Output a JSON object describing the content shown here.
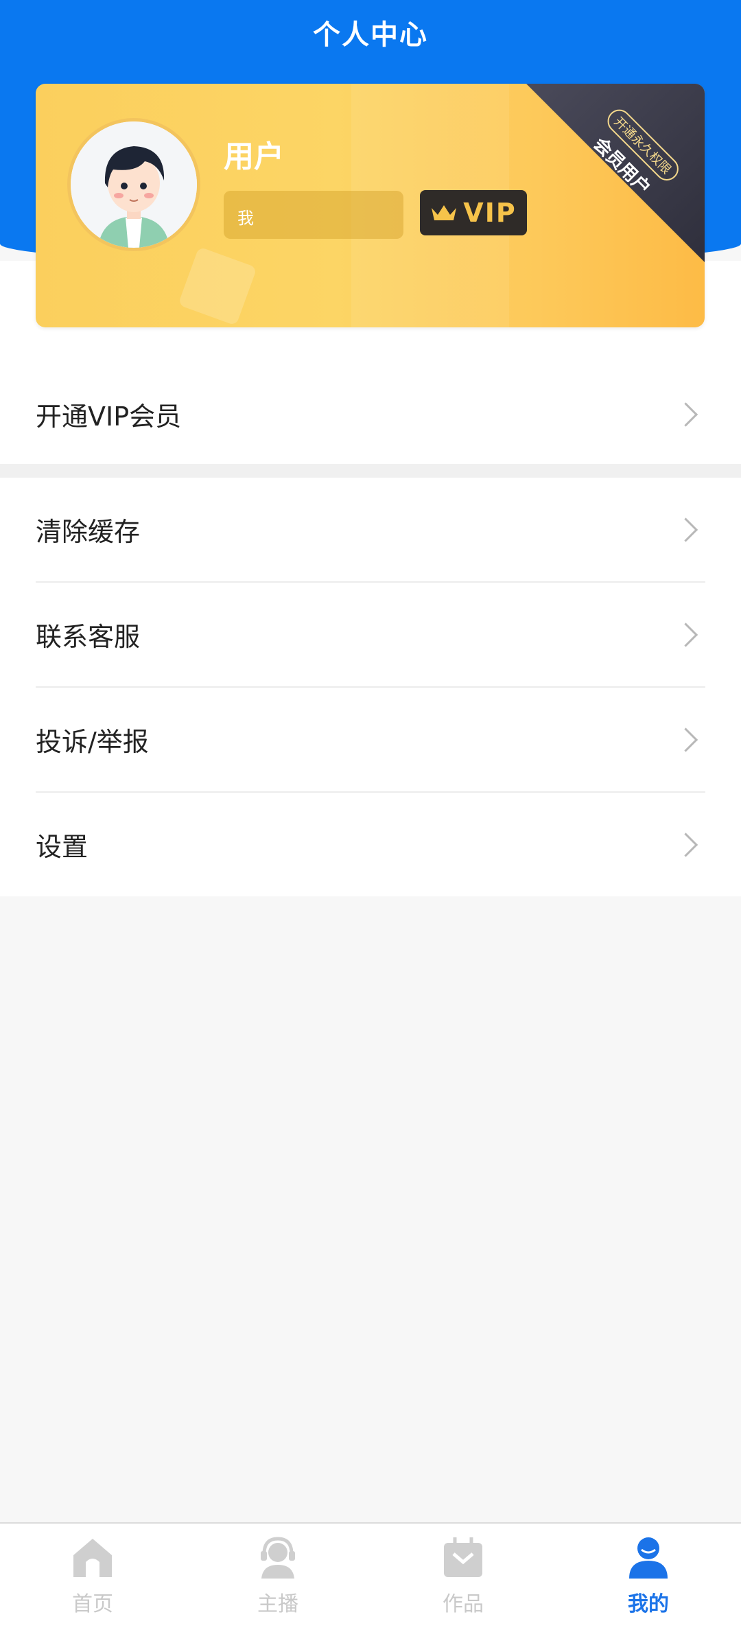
{
  "header": {
    "title": "个人中心"
  },
  "profile": {
    "name": "用户",
    "id_text": "我",
    "vip_label": "VIP",
    "corner_badge": "开通永久权限",
    "corner_label": "会员用户"
  },
  "menu": {
    "vip": "开通VIP会员",
    "clear_cache": "清除缓存",
    "contact": "联系客服",
    "report": "投诉/举报",
    "settings": "设置"
  },
  "tabs": [
    {
      "label": "首页",
      "icon": "home-icon",
      "active": false
    },
    {
      "label": "主播",
      "icon": "headset-icon",
      "active": false
    },
    {
      "label": "作品",
      "icon": "works-icon",
      "active": false
    },
    {
      "label": "我的",
      "icon": "user-icon",
      "active": true
    }
  ],
  "colors": {
    "primary": "#0a78f0",
    "card_gold": "#fcd565",
    "vip_gold": "#f6c34a",
    "tab_active": "#1b73e8"
  }
}
